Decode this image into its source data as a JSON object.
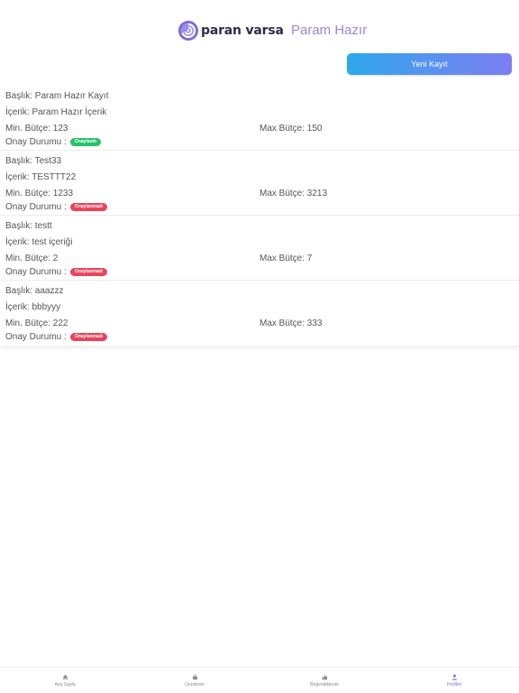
{
  "header": {
    "logo_text": "paran varsa",
    "title": "Param Hazır"
  },
  "actions": {
    "new_record": "Yeni Kayıt"
  },
  "records": [
    {
      "title": "Başlık: Param Hazır Kayıt",
      "content": "İçerik: Param Hazır İçerik",
      "min": "Min. Bütçe: 123",
      "max": "Max Bütçe: 150",
      "status_label": "Onay Durumu :",
      "status": "Onaylandı",
      "approved": true
    },
    {
      "title": "Başlık: Test33",
      "content": "İçerik: TESTTT22",
      "min": "Min. Bütçe: 1233",
      "max": "Max Bütçe: 3213",
      "status_label": "Onay Durumu :",
      "status": "Onaylanmadı",
      "approved": false
    },
    {
      "title": "Başlık: testt",
      "content": "İçerik: test içeriği",
      "min": "Min. Bütçe: 2",
      "max": "Max Bütçe: 7",
      "status_label": "Onay Durumu :",
      "status": "Onaylanmadı",
      "approved": false
    },
    {
      "title": "Başlık: aaazzz",
      "content": "İçerik: bbbyyy",
      "min": "Min. Bütçe: 222",
      "max": "Max Bütçe: 333",
      "status_label": "Onay Durumu :",
      "status": "Onaylanmadı",
      "approved": false
    }
  ],
  "tabbar": {
    "items": [
      {
        "label": "Ana Sayfa",
        "icon": "home-icon"
      },
      {
        "label": "Ürünlerim",
        "icon": "basket-icon"
      },
      {
        "label": "Beğendiklerim",
        "icon": "thumbs-up-icon"
      },
      {
        "label": "Profilim",
        "icon": "user-icon",
        "active": true
      }
    ]
  },
  "colors": {
    "accent": "#9a86e0",
    "approved": "#27c26a",
    "not_approved": "#e8455c",
    "button_start": "#2fa8ea",
    "button_end": "#7b7ef0"
  }
}
